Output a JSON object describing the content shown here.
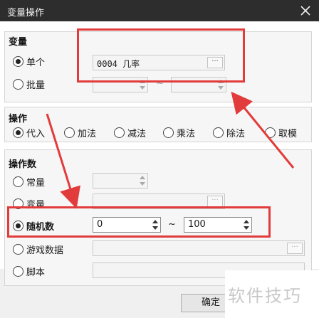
{
  "window": {
    "title": "变量操作"
  },
  "variable_group": {
    "title": "变量",
    "single_label": "单个",
    "single_value": "0004 几率",
    "batch_label": "批量",
    "batch_sep": "~"
  },
  "operation_group": {
    "title": "操作",
    "options": [
      "代入",
      "加法",
      "减法",
      "乘法",
      "除法",
      "取模"
    ],
    "selected": "代入"
  },
  "operand_group": {
    "title": "操作数",
    "constant_label": "常量",
    "variable_label": "变量",
    "random_label": "随机数",
    "random_min": "0",
    "random_max": "100",
    "random_sep": "~",
    "game_data_label": "游戏数据",
    "script_label": "脚本"
  },
  "buttons": {
    "ok": "确定"
  },
  "watermark": "软件技巧",
  "icons": {
    "close": "close-icon",
    "browse": "ellipsis-icon"
  },
  "colors": {
    "highlight": "#e23b3b",
    "titlebar": "#2d2d2d"
  }
}
